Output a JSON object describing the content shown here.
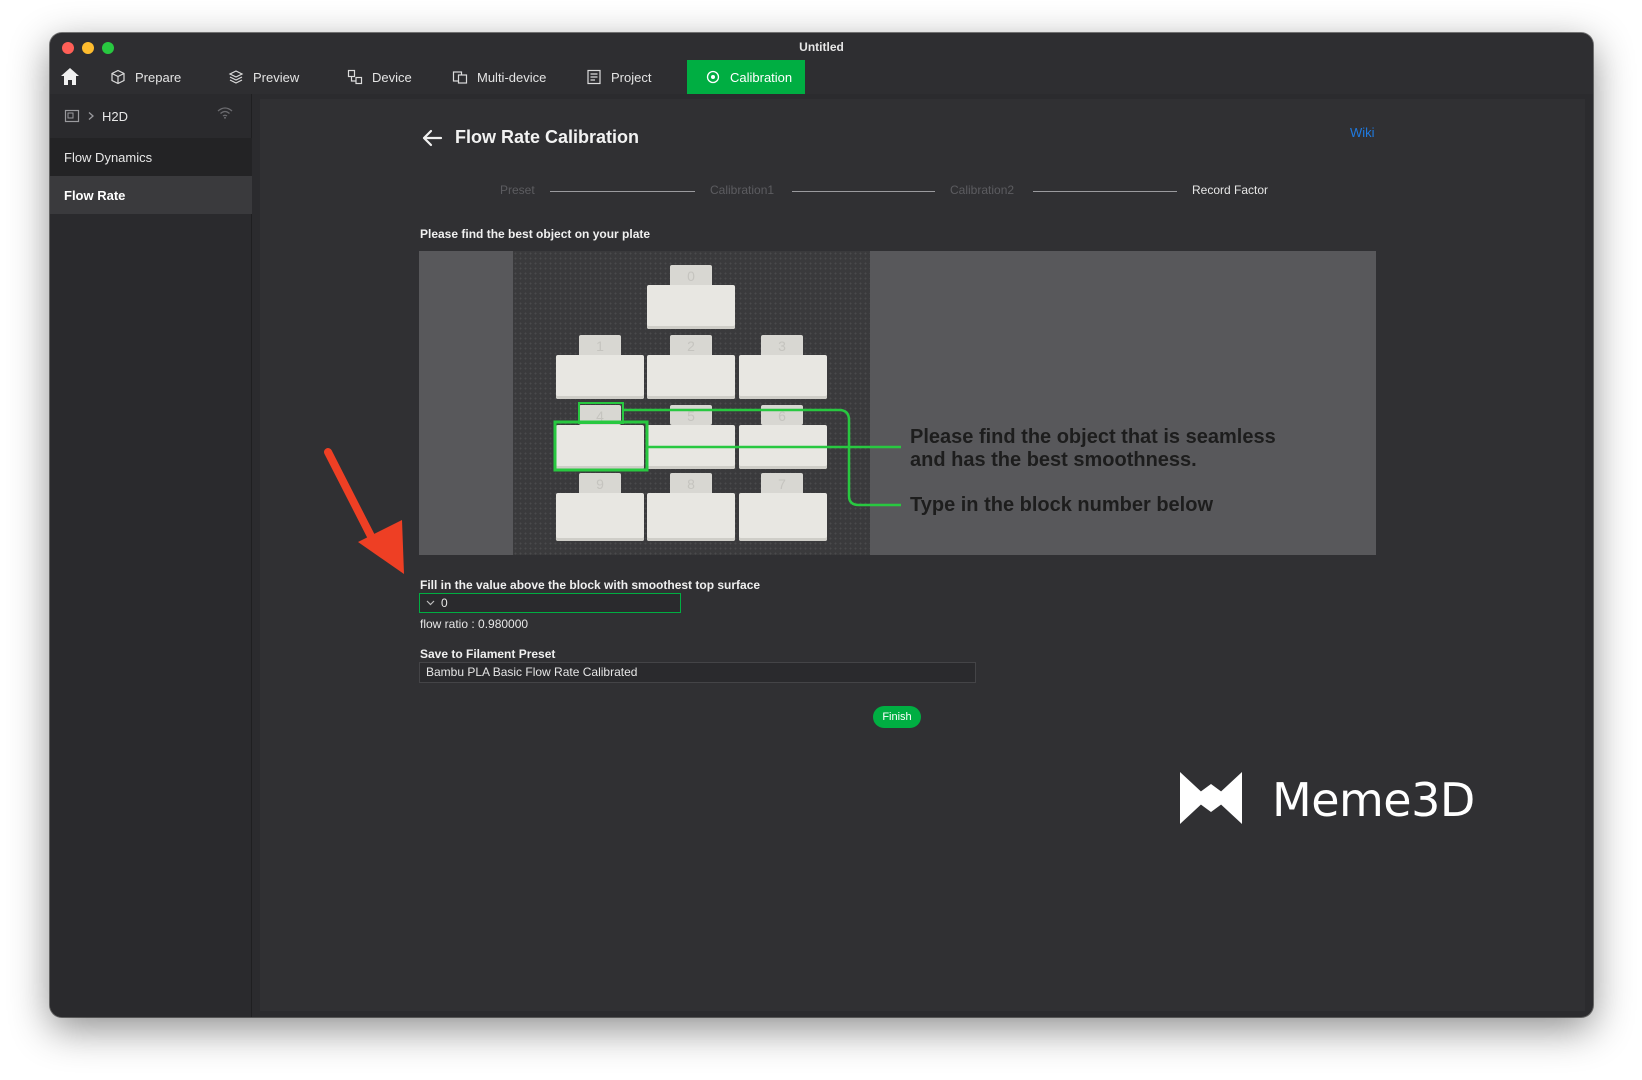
{
  "window": {
    "title": "Untitled"
  },
  "tabs": [
    {
      "label": "Prepare",
      "icon": "cube-icon"
    },
    {
      "label": "Preview",
      "icon": "layers-icon"
    },
    {
      "label": "Device",
      "icon": "device-icon"
    },
    {
      "label": "Multi-device",
      "icon": "multi-device-icon"
    },
    {
      "label": "Project",
      "icon": "project-icon"
    },
    {
      "label": "Calibration",
      "icon": "calibration-icon",
      "active": true
    }
  ],
  "sidebar": {
    "device_name": "H2D",
    "items": [
      {
        "label": "Flow Dynamics"
      },
      {
        "label": "Flow Rate",
        "selected": true
      }
    ]
  },
  "main": {
    "title": "Flow Rate Calibration",
    "wiki_label": "Wiki",
    "steps": [
      "Preset",
      "Calibration1",
      "Calibration2",
      "Record Factor"
    ],
    "current_step": "Record Factor",
    "instruction": "Please find the best object on your plate",
    "panel": {
      "block_numbers": [
        "0",
        "1",
        "2",
        "3",
        "4",
        "5",
        "6",
        "7",
        "8",
        "9"
      ],
      "callout_line1": "Please find the object that is seamless",
      "callout_line2": "and has the best smoothness.",
      "callout_line3": "Type in the block number below"
    },
    "fill_label": "Fill in the value above the block with smoothest top surface",
    "combo_value": "0",
    "flow_ratio": "flow ratio : 0.980000",
    "save_label": "Save to Filament Preset",
    "preset_value": "Bambu PLA Basic Flow Rate Calibrated",
    "finish_label": "Finish"
  },
  "watermark": {
    "text": "Meme3D"
  },
  "colors": {
    "accent": "#00ae42",
    "link": "#1f7ae0",
    "annotation_arrow": "#ee3f24"
  }
}
